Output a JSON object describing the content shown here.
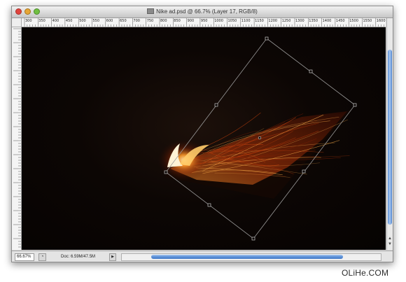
{
  "window": {
    "title": "Nike ad.psd @ 66.7% (Layer 17, RGB/8)"
  },
  "ruler": {
    "top_ticks": [
      "300",
      "350",
      "400",
      "450",
      "500",
      "550",
      "600",
      "650",
      "700",
      "750",
      "800",
      "850",
      "900",
      "950",
      "1000",
      "1050",
      "1100",
      "1150",
      "1200",
      "1250",
      "1300",
      "1350",
      "1400",
      "1450",
      "1500",
      "1550",
      "1600"
    ]
  },
  "statusbar": {
    "zoom": "66.67%",
    "doc_info": "Doc: 6.59M/47.5M"
  },
  "watermark": "OLiHe.COM",
  "colors": {
    "canvas_bg": "#0a0503",
    "flame": "#ff8a1e",
    "scroll_accent": "#5a8fd6"
  }
}
